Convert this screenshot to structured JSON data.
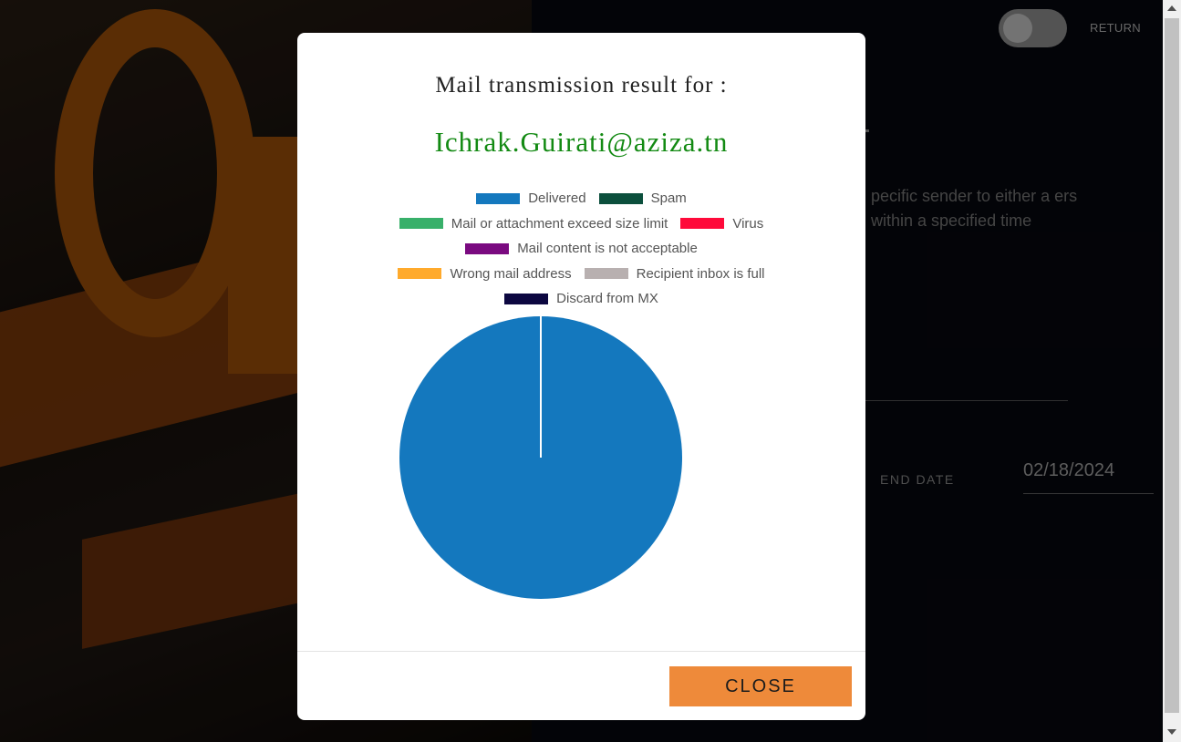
{
  "background": {
    "return_label": "RETURN",
    "description": "pecific sender to either a ers within a specified time",
    "end_date_label": "END DATE",
    "end_date_value": "02/18/2024"
  },
  "modal": {
    "title": "Mail transmission result for :",
    "email": "Ichrak.Guirati@aziza.tn",
    "close_label": "CLOSE"
  },
  "chart_data": {
    "type": "pie",
    "legend_placement": "top",
    "categories": [
      "Delivered",
      "Spam",
      "Mail or attachment exceed size limit",
      "Virus",
      "Mail content is not acceptable",
      "Wrong mail address",
      "Recipient inbox is full",
      "Discard from MX"
    ],
    "values": [
      1,
      0,
      0,
      0,
      0,
      0,
      0,
      0
    ],
    "colors": [
      "#1478be",
      "#0b4f3c",
      "#38b06a",
      "#ff0a3a",
      "#7a0a80",
      "#ffaa2c",
      "#b8b0b0",
      "#0c0740"
    ]
  }
}
